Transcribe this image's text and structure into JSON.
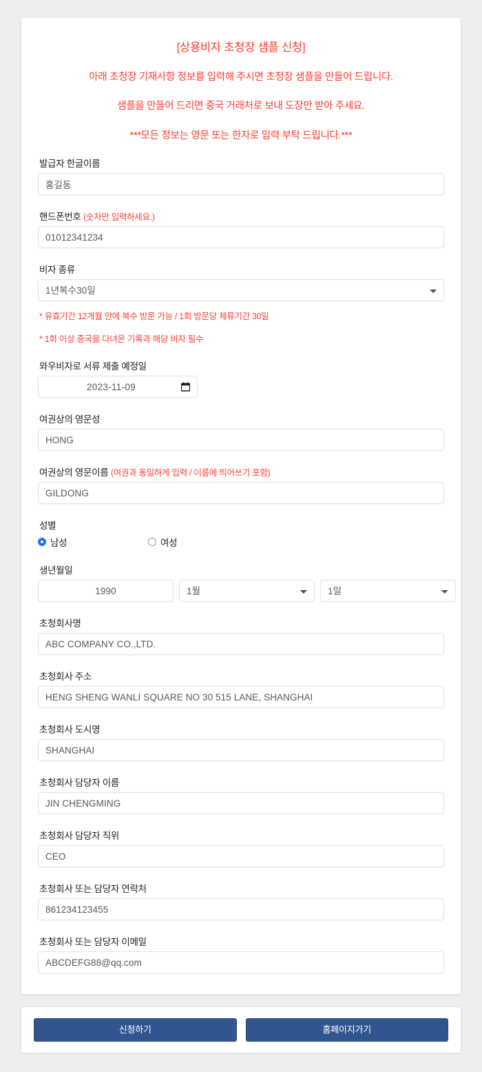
{
  "notice": {
    "title": "[상용비자 초청장 샘플 신청]",
    "line1": "아래 초청장 기재사항 정보를 입력해 주시면 초청장 샘플을 만들어 드립니다.",
    "line2": "샘플을 만들어 드리면 중국 거래처로 보내 도장만 받아 주세요.",
    "line3": "***모든 정보는 영문 또는 한자로 입력 부탁 드립니다.***"
  },
  "fields": {
    "korean_name": {
      "label": "발급자 한글이름",
      "value": "홍길동"
    },
    "phone": {
      "label": "핸드폰번호",
      "hint": "(숫자만 입력하세요.)",
      "value": "01012341234"
    },
    "visa_type": {
      "label": "비자 종류",
      "value": "1년복수30일",
      "options": [
        "1년복수30일"
      ],
      "note1": "* 유효기간 12개월 안에 복수 방문 가능 / 1회 방문당 체류기간 30일",
      "note2": "* 1회 이상 중국을 다녀온 기록과 해당 비자 필수"
    },
    "submit_date": {
      "label": "와우비자로 서류 제출 예정일",
      "value": "2023-11-09"
    },
    "surname": {
      "label": "여권상의 영문성",
      "value": "HONG"
    },
    "given_name": {
      "label": "여권상의 영문이름",
      "hint": "(여권과 동일하게 입력 / 이름에 띄어쓰기 포함)",
      "value": "GILDONG"
    },
    "gender": {
      "label": "성별",
      "male_label": "남성",
      "female_label": "여성",
      "selected": "male"
    },
    "birth": {
      "label": "생년월일",
      "year": "1990",
      "month": "1월",
      "day": "1일",
      "month_options": [
        "1월"
      ],
      "day_options": [
        "1일"
      ]
    },
    "company_name": {
      "label": "초청회사명",
      "value": "ABC COMPANY CO.,LTD."
    },
    "company_address": {
      "label": "초청회사 주소",
      "value": "HENG SHENG WANLI SQUARE NO 30 515 LANE, SHANGHAI"
    },
    "company_city": {
      "label": "초청회사 도시명",
      "value": "SHANGHAI"
    },
    "contact_name": {
      "label": "초청회사 담당자 이름",
      "value": "JIN CHENGMING"
    },
    "contact_title": {
      "label": "초청회사 담당자 직위",
      "value": "CEO"
    },
    "contact_phone": {
      "label": "초청회사 또는 담당자 연락처",
      "value": "861234123455"
    },
    "contact_email": {
      "label": "초청회사 또는 담당자 이메일",
      "value": "ABCDEFG88@qq.com"
    }
  },
  "buttons": {
    "submit": "신청하기",
    "homepage": "홈페이지가기"
  },
  "colors": {
    "notice_red": "#ff3b30",
    "button_blue": "#31558f",
    "radio_blue": "#1a73e8",
    "page_bg": "#eeeeee"
  }
}
